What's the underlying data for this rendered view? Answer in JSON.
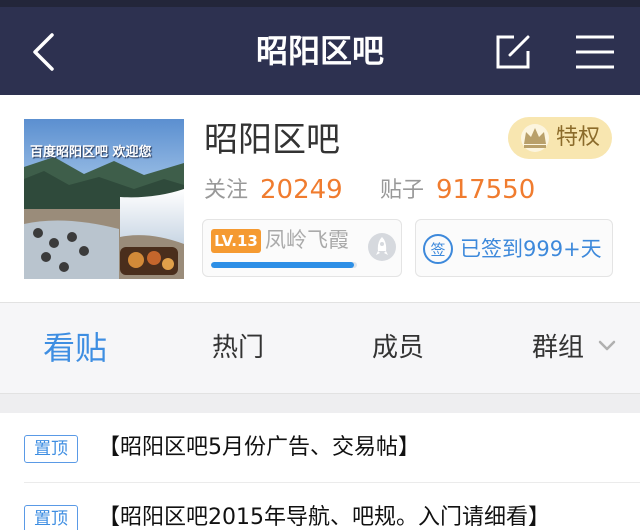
{
  "header": {
    "title": "昭阳区吧",
    "back_icon": "back-arrow-icon",
    "edit_icon": "compose-icon",
    "menu_icon": "hamburger-menu-icon",
    "bar_color": "#2d3150"
  },
  "forum": {
    "name": "昭阳区吧",
    "avatar_caption": "百度昭阳区吧 欢迎您",
    "privilege_label": "特权",
    "followers_label": "关注",
    "followers_count": "20249",
    "posts_label": "贴子",
    "posts_count": "917550",
    "accent_color": "#f07c2f"
  },
  "user": {
    "level_badge": "LV.13",
    "name": "凤岭飞霞",
    "level_progress": 0.98,
    "checkin_icon_char": "签",
    "checkin_text": "已签到999+天"
  },
  "tabs": [
    {
      "label": "看贴",
      "active": true
    },
    {
      "label": "热门",
      "active": false
    },
    {
      "label": "成员",
      "active": false
    },
    {
      "label": "群组",
      "active": false
    }
  ],
  "threads": [
    {
      "tag": "置顶",
      "title": "【昭阳区吧5月份广告、交易帖】"
    },
    {
      "tag": "置顶",
      "title": "【昭阳区吧2015年导航、吧规。入门请细看】"
    }
  ]
}
